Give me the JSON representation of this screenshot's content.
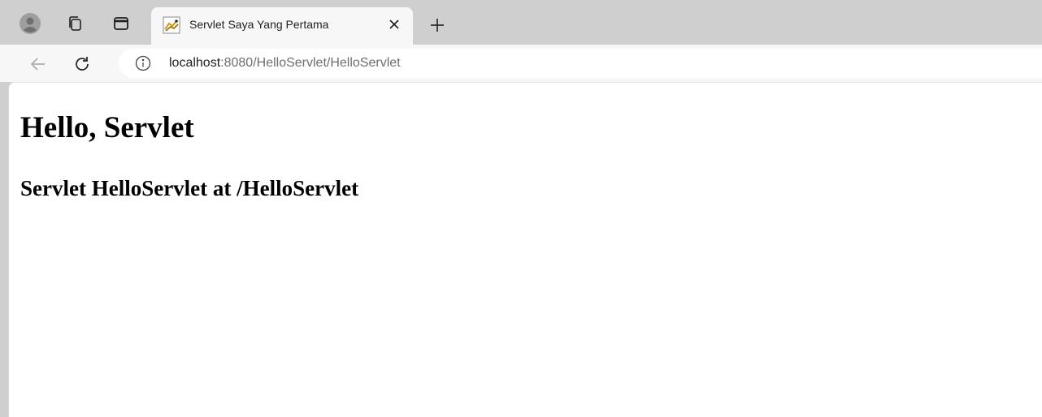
{
  "browser": {
    "tab": {
      "title": "Servlet Saya Yang Pertama",
      "favicon": "tomcat-favicon-icon",
      "close_glyph": "×"
    },
    "new_tab_glyph": "+",
    "toolbar_icons": [
      "profile-icon",
      "workspaces-icon",
      "tab-actions-icon"
    ],
    "address_bar": {
      "host": "localhost",
      "path": ":8080/HelloServlet/HelloServlet"
    }
  },
  "page": {
    "heading": "Hello, Servlet",
    "subheading": "Servlet HelloServlet at /HelloServlet"
  },
  "colors": {
    "chrome_background": "#cfcfcf",
    "toolbar_background": "#f7f7f7",
    "page_background": "#ffffff"
  }
}
